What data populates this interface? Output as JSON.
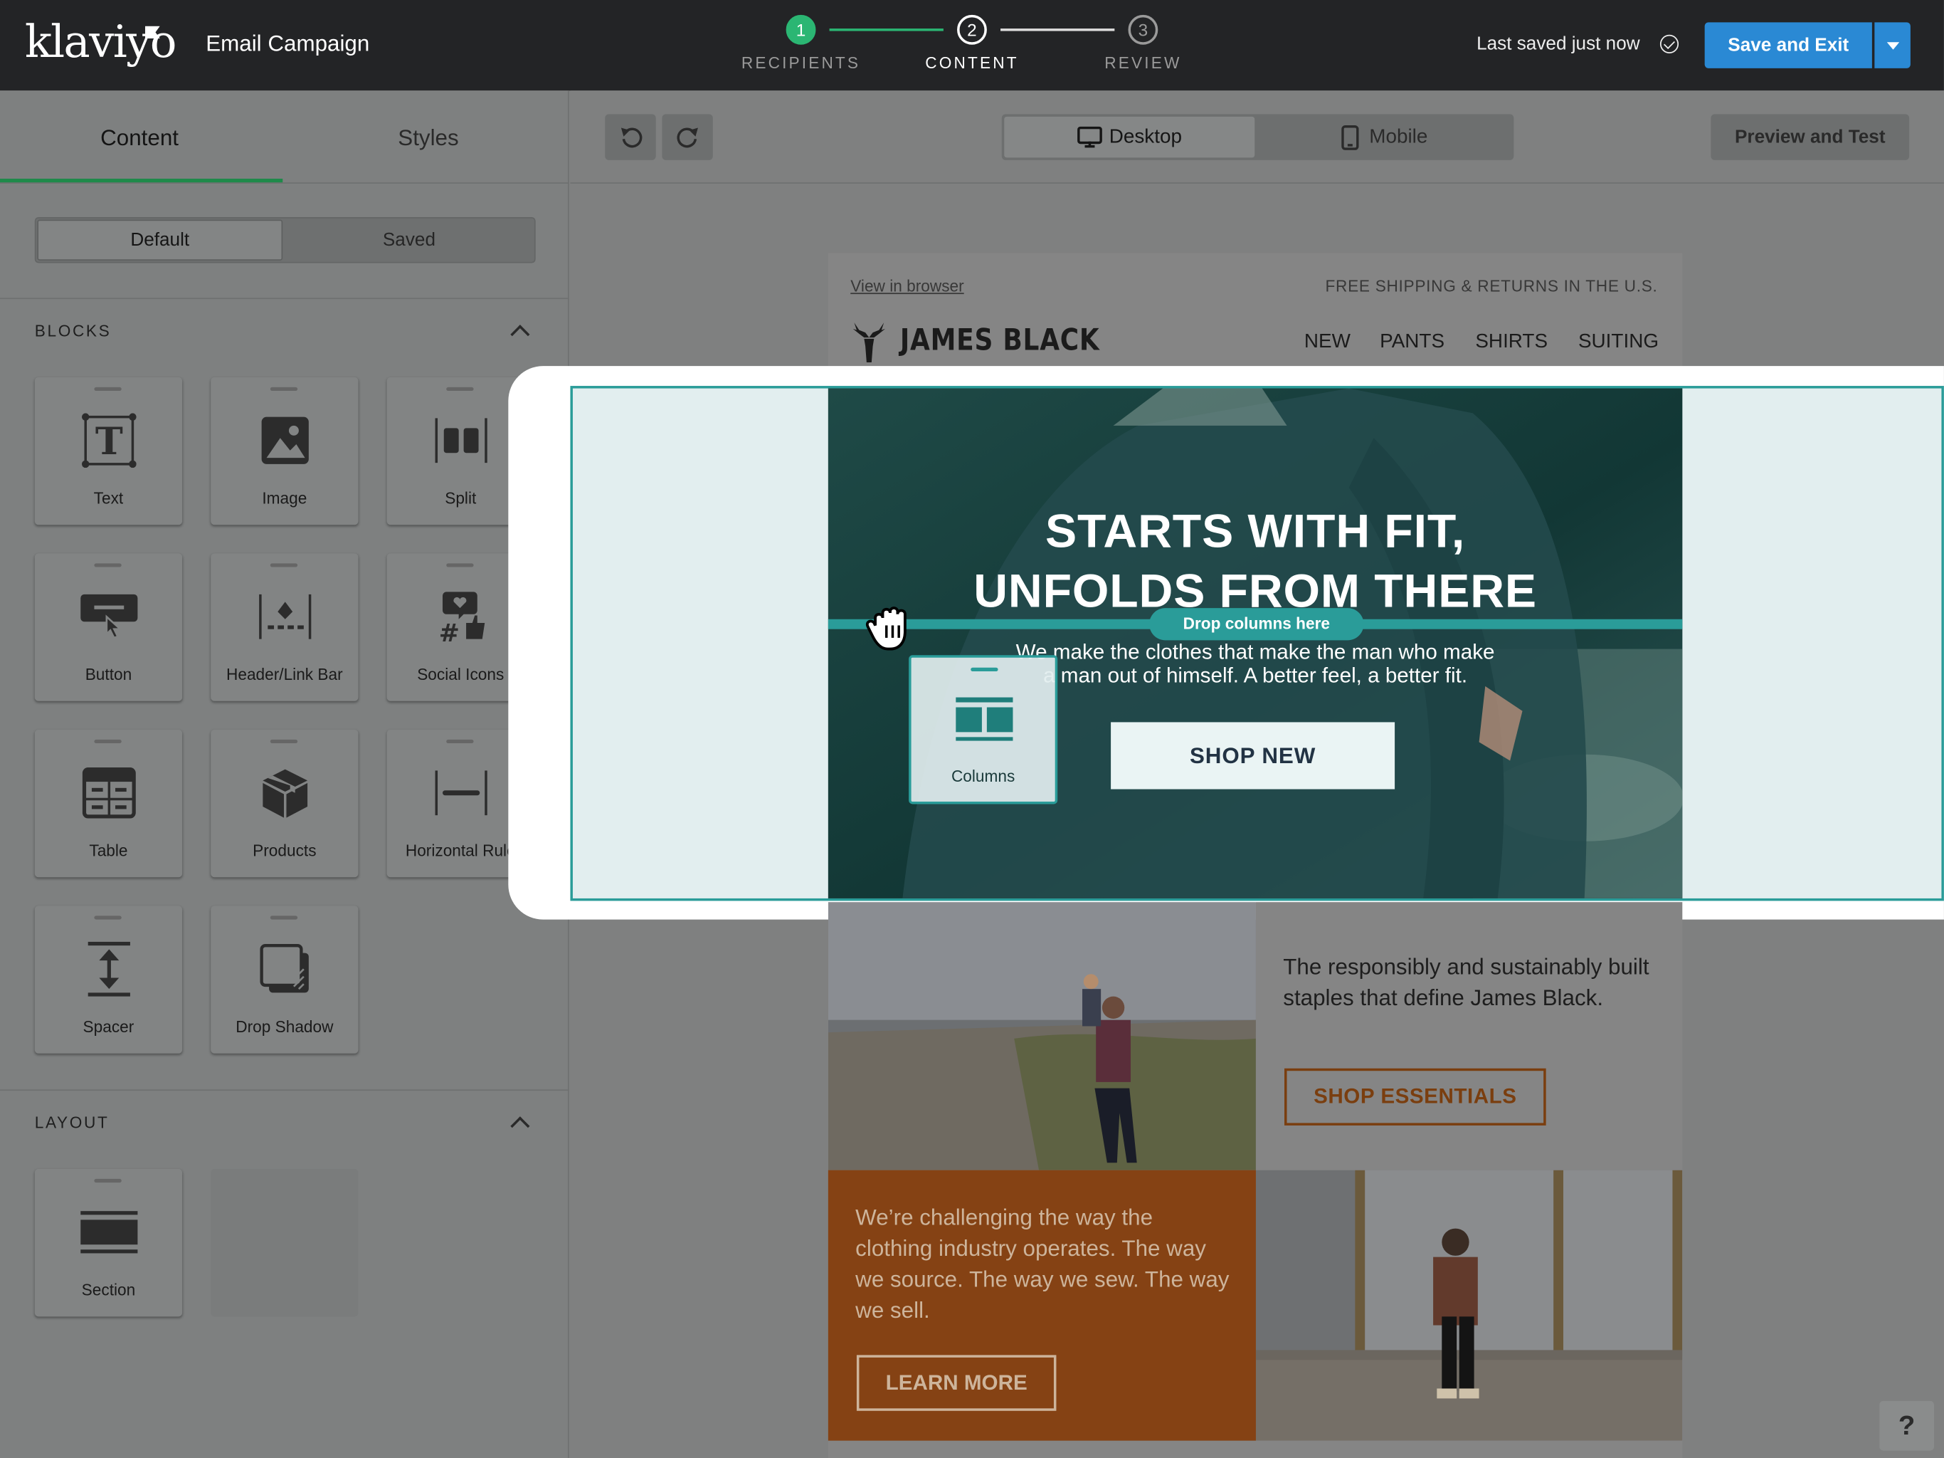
{
  "topbar": {
    "logo": "klaviyo",
    "title": "Email Campaign",
    "steps": [
      {
        "num": "1",
        "label": "RECIPIENTS"
      },
      {
        "num": "2",
        "label": "CONTENT"
      },
      {
        "num": "3",
        "label": "REVIEW"
      }
    ],
    "saved_text": "Last saved just now",
    "save_label": "Save and Exit"
  },
  "sidebar": {
    "tab_content": "Content",
    "tab_styles": "Styles",
    "seg_default": "Default",
    "seg_saved": "Saved",
    "blocks_heading": "BLOCKS",
    "blocks": [
      {
        "label": "Text",
        "icon": "text-icon"
      },
      {
        "label": "Image",
        "icon": "image-icon"
      },
      {
        "label": "Split",
        "icon": "split-icon"
      },
      {
        "label": "Button",
        "icon": "button-icon"
      },
      {
        "label": "Header/Link Bar",
        "icon": "header-link-bar-icon"
      },
      {
        "label": "Social Icons",
        "icon": "social-icons-icon"
      },
      {
        "label": "Table",
        "icon": "table-icon"
      },
      {
        "label": "Products",
        "icon": "products-icon"
      },
      {
        "label": "Horizontal Rule",
        "icon": "horizontal-rule-icon"
      },
      {
        "label": "Spacer",
        "icon": "spacer-icon"
      },
      {
        "label": "Drop Shadow",
        "icon": "drop-shadow-icon"
      }
    ],
    "layout_heading": "LAYOUT",
    "layout": [
      {
        "label": "Section",
        "icon": "section-icon"
      }
    ]
  },
  "toolbar": {
    "desktop": "Desktop",
    "mobile": "Mobile",
    "preview": "Preview and Test"
  },
  "email": {
    "view_in_browser": "View in browser",
    "shipping": "FREE SHIPPING & RETURNS IN THE U.S.",
    "brand": "JAMES BLACK",
    "nav": [
      "NEW",
      "PANTS",
      "SHIRTS",
      "SUITING"
    ],
    "hero_line1": "STARTS WITH FIT,",
    "hero_line2": "UNFOLDS FROM THERE",
    "hero_sub1": "We make the clothes that make the man who make",
    "hero_sub2": "a man out of himself. A better feel, a better fit.",
    "shop_new": "SHOP NEW",
    "drop_hint": "Drop columns here",
    "drag_label": "Columns",
    "row1_text": "The responsibly and sustainably built staples that define James Black.",
    "shop_essentials": "SHOP ESSENTIALS",
    "row2_text": "We’re challenging the way the clothing industry operates. The way we source. The way we sew. The way we sell.",
    "learn_more": "LEARN MORE"
  },
  "help": "?",
  "colors": {
    "accent_green": "#2bb673",
    "save_blue": "#2a89d4",
    "drop_teal": "#2a9c99",
    "rust": "#854214"
  }
}
